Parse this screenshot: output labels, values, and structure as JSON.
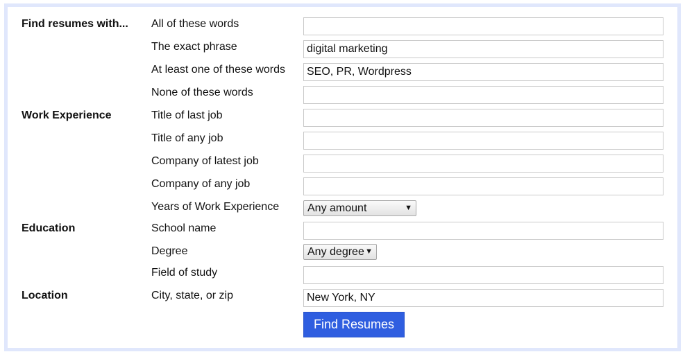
{
  "sections": {
    "keywords": "Find resumes with...",
    "work": "Work Experience",
    "education": "Education",
    "location": "Location"
  },
  "fields": {
    "all_words": {
      "label": "All of these words",
      "value": ""
    },
    "exact_phrase": {
      "label": "The exact phrase",
      "value": "digital marketing"
    },
    "any_words": {
      "label": "At least one of these words",
      "value": "SEO, PR, Wordpress"
    },
    "none_words": {
      "label": "None of these words",
      "value": ""
    },
    "title_last": {
      "label": "Title of last job",
      "value": ""
    },
    "title_any": {
      "label": "Title of any job",
      "value": ""
    },
    "company_latest": {
      "label": "Company of latest job",
      "value": ""
    },
    "company_any": {
      "label": "Company of any job",
      "value": ""
    },
    "years_exp": {
      "label": "Years of Work Experience",
      "selected": "Any amount"
    },
    "school": {
      "label": "School name",
      "value": ""
    },
    "degree": {
      "label": "Degree",
      "selected": "Any degree"
    },
    "field_study": {
      "label": "Field of study",
      "value": ""
    },
    "city": {
      "label": "City, state, or zip",
      "value": "New York, NY"
    }
  },
  "icons": {
    "dropdown_arrow": "▼"
  },
  "submit_label": "Find Resumes",
  "colors": {
    "frame": "#e0e7fc",
    "button": "#2f5ee0"
  }
}
